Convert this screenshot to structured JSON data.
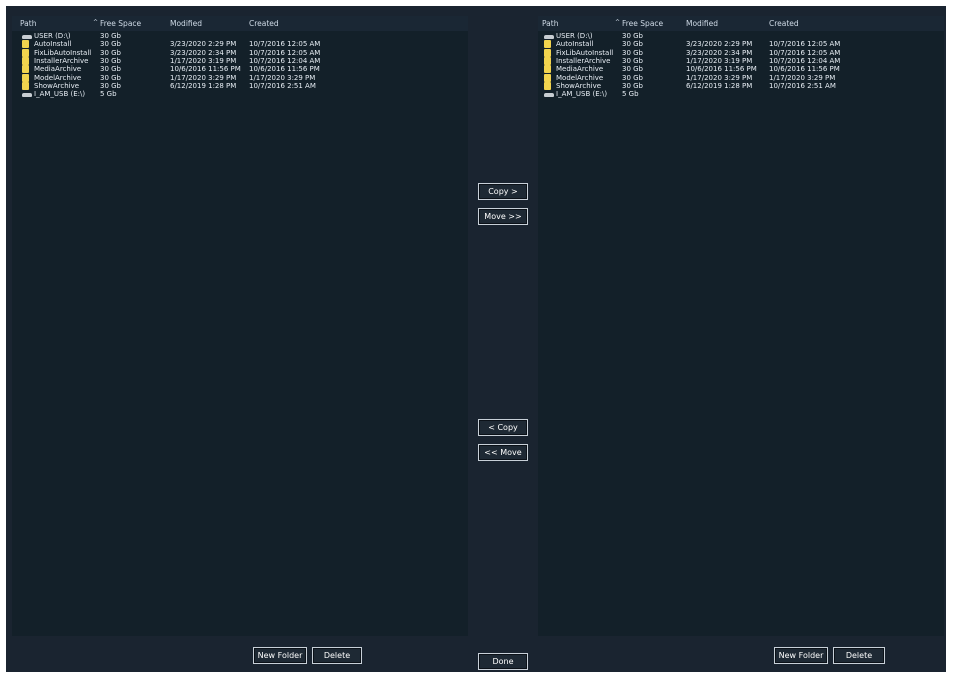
{
  "columns": {
    "path": "Path",
    "sort_arrow": "^",
    "free_space": "Free Space",
    "modified": "Modified",
    "created": "Created"
  },
  "left_pane": {
    "rows": [
      {
        "type": "drive",
        "icon": "drive-icon",
        "name": "USER (D:\\)",
        "free": "30 Gb",
        "modified": "",
        "created": ""
      },
      {
        "type": "folder",
        "icon": "folder-icon",
        "name": "AutoInstall",
        "free": "30 Gb",
        "modified": "3/23/2020 2:29 PM",
        "created": "10/7/2016 12:05 AM"
      },
      {
        "type": "folder",
        "icon": "folder-icon",
        "name": "FixLibAutoInstall",
        "free": "30 Gb",
        "modified": "3/23/2020 2:34 PM",
        "created": "10/7/2016 12:05 AM"
      },
      {
        "type": "folder",
        "icon": "folder-icon",
        "name": "InstallerArchive",
        "free": "30 Gb",
        "modified": "1/17/2020 3:19 PM",
        "created": "10/7/2016 12:04 AM"
      },
      {
        "type": "folder",
        "icon": "folder-icon",
        "name": "MediaArchive",
        "free": "30 Gb",
        "modified": "10/6/2016 11:56 PM",
        "created": "10/6/2016 11:56 PM"
      },
      {
        "type": "folder",
        "icon": "folder-icon",
        "name": "ModelArchive",
        "free": "30 Gb",
        "modified": "1/17/2020 3:29 PM",
        "created": "1/17/2020 3:29 PM"
      },
      {
        "type": "folder",
        "icon": "folder-icon",
        "name": "ShowArchive",
        "free": "30 Gb",
        "modified": "6/12/2019 1:28 PM",
        "created": "10/7/2016 2:51 AM"
      },
      {
        "type": "drive",
        "icon": "drive-icon",
        "name": "I_AM_USB (E:\\)",
        "free": "5 Gb",
        "modified": "",
        "created": ""
      }
    ],
    "new_folder_label": "New Folder",
    "delete_label": "Delete"
  },
  "right_pane": {
    "rows": [
      {
        "type": "drive",
        "icon": "drive-icon",
        "name": "USER (D:\\)",
        "free": "30 Gb",
        "modified": "",
        "created": ""
      },
      {
        "type": "folder",
        "icon": "folder-icon",
        "name": "AutoInstall",
        "free": "30 Gb",
        "modified": "3/23/2020 2:29 PM",
        "created": "10/7/2016 12:05 AM"
      },
      {
        "type": "folder",
        "icon": "folder-icon",
        "name": "FixLibAutoInstall",
        "free": "30 Gb",
        "modified": "3/23/2020 2:34 PM",
        "created": "10/7/2016 12:05 AM"
      },
      {
        "type": "folder",
        "icon": "folder-icon",
        "name": "InstallerArchive",
        "free": "30 Gb",
        "modified": "1/17/2020 3:19 PM",
        "created": "10/7/2016 12:04 AM"
      },
      {
        "type": "folder",
        "icon": "folder-icon",
        "name": "MediaArchive",
        "free": "30 Gb",
        "modified": "10/6/2016 11:56 PM",
        "created": "10/6/2016 11:56 PM"
      },
      {
        "type": "folder",
        "icon": "folder-icon",
        "name": "ModelArchive",
        "free": "30 Gb",
        "modified": "1/17/2020 3:29 PM",
        "created": "1/17/2020 3:29 PM"
      },
      {
        "type": "folder",
        "icon": "folder-icon",
        "name": "ShowArchive",
        "free": "30 Gb",
        "modified": "6/12/2019 1:28 PM",
        "created": "10/7/2016 2:51 AM"
      },
      {
        "type": "drive",
        "icon": "drive-icon",
        "name": "I_AM_USB (E:\\)",
        "free": "5 Gb",
        "modified": "",
        "created": ""
      }
    ],
    "new_folder_label": "New Folder",
    "delete_label": "Delete"
  },
  "transfer": {
    "copy_right_label": "Copy >",
    "move_right_label": "Move >>",
    "copy_left_label": "< Copy",
    "move_left_label": "<< Move"
  },
  "done_label": "Done",
  "colors": {
    "background": "#1a2430",
    "pane": "#132029",
    "folder": "#f2d44e",
    "text": "#e8eef5"
  }
}
